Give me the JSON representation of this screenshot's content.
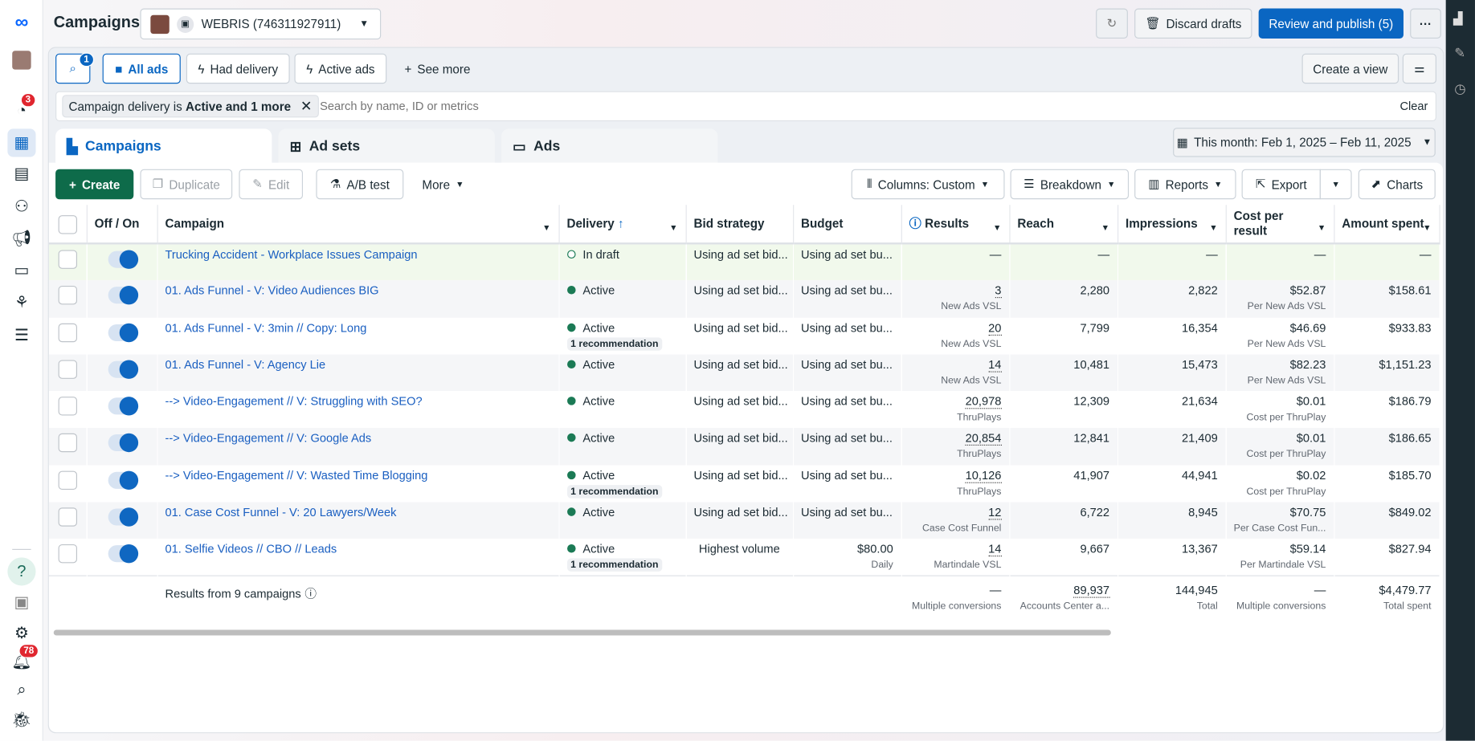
{
  "header": {
    "title": "Campaigns",
    "account": "WEBRIS (746311927911)",
    "refresh_icon": "refresh-icon",
    "discard": "Discard drafts",
    "publish": "Review and publish (5)",
    "more": "···"
  },
  "nav": {
    "notif_badge": "3",
    "bell_badge": "78",
    "help": "?"
  },
  "filters": {
    "search_badge": "1",
    "all_ads": "All ads",
    "had_delivery": "Had delivery",
    "active_ads": "Active ads",
    "see_more": "See more",
    "create_view": "Create a view"
  },
  "search": {
    "chip_prefix": "Campaign delivery is ",
    "chip_bold": "Active and 1 more",
    "placeholder": "Search by name, ID or metrics",
    "clear": "Clear"
  },
  "tabs": [
    {
      "label": "Campaigns"
    },
    {
      "label": "Ad sets"
    },
    {
      "label": "Ads"
    }
  ],
  "date_range": "This month: Feb 1, 2025 – Feb 11, 2025",
  "toolbar": {
    "create": "Create",
    "duplicate": "Duplicate",
    "edit": "Edit",
    "ab_test": "A/B test",
    "more": "More",
    "columns": "Columns: Custom",
    "breakdown": "Breakdown",
    "reports": "Reports",
    "export": "Export",
    "charts": "Charts"
  },
  "columns": [
    "Off / On",
    "Campaign",
    "Delivery",
    "Bid strategy",
    "Budget",
    "Results",
    "Reach",
    "Impressions",
    "Cost per result",
    "Amount spent"
  ],
  "colors": {
    "accent": "#0a66c2",
    "create": "#0e6b4a",
    "active": "#1b7a55",
    "draft_row": "#f1f9ec"
  },
  "rows": [
    {
      "name": "Trucking Accident - Workplace Issues Campaign",
      "delivery": "In draft",
      "draft": true,
      "bid": "Using ad set bid...",
      "budget": "Using ad set bu...",
      "budget_sub": "",
      "results": "—",
      "results_sub": "",
      "reach": "—",
      "impressions": "—",
      "cpr": "—",
      "cpr_sub": "",
      "spent": "—",
      "rec": ""
    },
    {
      "name": "01. Ads Funnel - V: Video Audiences BIG",
      "delivery": "Active",
      "bid": "Using ad set bid...",
      "budget": "Using ad set bu...",
      "budget_sub": "",
      "results": "3",
      "results_sub": "New Ads VSL",
      "reach": "2,280",
      "impressions": "2,822",
      "cpr": "$52.87",
      "cpr_sub": "Per New Ads VSL",
      "spent": "$158.61",
      "rec": ""
    },
    {
      "name": "01. Ads Funnel - V: 3min // Copy: Long",
      "delivery": "Active",
      "bid": "Using ad set bid...",
      "budget": "Using ad set bu...",
      "budget_sub": "",
      "results": "20",
      "results_sub": "New Ads VSL",
      "reach": "7,799",
      "impressions": "16,354",
      "cpr": "$46.69",
      "cpr_sub": "Per New Ads VSL",
      "spent": "$933.83",
      "rec": "1 recommendation"
    },
    {
      "name": "01. Ads Funnel - V: Agency Lie",
      "delivery": "Active",
      "bid": "Using ad set bid...",
      "budget": "Using ad set bu...",
      "budget_sub": "",
      "results": "14",
      "results_sub": "New Ads VSL",
      "reach": "10,481",
      "impressions": "15,473",
      "cpr": "$82.23",
      "cpr_sub": "Per New Ads VSL",
      "spent": "$1,151.23",
      "rec": ""
    },
    {
      "name": "--> Video-Engagement // V: Struggling with SEO?",
      "delivery": "Active",
      "bid": "Using ad set bid...",
      "budget": "Using ad set bu...",
      "budget_sub": "",
      "results": "20,978",
      "results_sub": "ThruPlays",
      "reach": "12,309",
      "impressions": "21,634",
      "cpr": "$0.01",
      "cpr_sub": "Cost per ThruPlay",
      "spent": "$186.79",
      "rec": ""
    },
    {
      "name": "--> Video-Engagement // V: Google Ads",
      "delivery": "Active",
      "bid": "Using ad set bid...",
      "budget": "Using ad set bu...",
      "budget_sub": "",
      "results": "20,854",
      "results_sub": "ThruPlays",
      "reach": "12,841",
      "impressions": "21,409",
      "cpr": "$0.01",
      "cpr_sub": "Cost per ThruPlay",
      "spent": "$186.65",
      "rec": ""
    },
    {
      "name": "--> Video-Engagement // V: Wasted Time Blogging",
      "delivery": "Active",
      "bid": "Using ad set bid...",
      "budget": "Using ad set bu...",
      "budget_sub": "",
      "results": "10,126",
      "results_sub": "ThruPlays",
      "reach": "41,907",
      "impressions": "44,941",
      "cpr": "$0.02",
      "cpr_sub": "Cost per ThruPlay",
      "spent": "$185.70",
      "rec": "1 recommendation"
    },
    {
      "name": "01. Case Cost Funnel - V: 20 Lawyers/Week",
      "delivery": "Active",
      "bid": "Using ad set bid...",
      "budget": "Using ad set bu...",
      "budget_sub": "",
      "results": "12",
      "results_sub": "Case Cost Funnel",
      "reach": "6,722",
      "impressions": "8,945",
      "cpr": "$70.75",
      "cpr_sub": "Per Case Cost Fun...",
      "spent": "$849.02",
      "rec": ""
    },
    {
      "name": "01. Selfie Videos // CBO // Leads",
      "delivery": "Active",
      "bid": "Highest volume",
      "bid_center": true,
      "budget": "$80.00",
      "budget_sub": "Daily",
      "results": "14",
      "results_sub": "Martindale VSL",
      "reach": "9,667",
      "impressions": "13,367",
      "cpr": "$59.14",
      "cpr_sub": "Per Martindale VSL",
      "spent": "$827.94",
      "rec": "1 recommendation"
    }
  ],
  "footer": {
    "label": "Results from 9 campaigns",
    "results": "—",
    "results_sub": "Multiple conversions",
    "reach": "89,937",
    "reach_sub": "Accounts Center a...",
    "impressions": "144,945",
    "impressions_sub": "Total",
    "cpr": "—",
    "cpr_sub": "Multiple conversions",
    "spent": "$4,479.77",
    "spent_sub": "Total spent"
  }
}
